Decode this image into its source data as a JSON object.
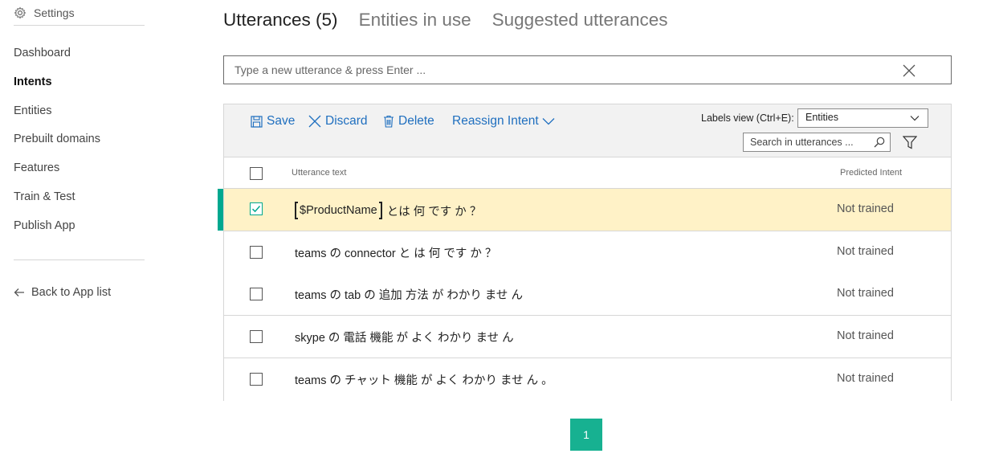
{
  "sidebar": {
    "settings_label": "Settings",
    "items": [
      {
        "label": "Dashboard"
      },
      {
        "label": "Intents"
      },
      {
        "label": "Entities"
      },
      {
        "label": "Prebuilt domains"
      },
      {
        "label": "Features"
      },
      {
        "label": "Train & Test"
      },
      {
        "label": "Publish App"
      }
    ],
    "back_label": "Back to App list"
  },
  "tabs": [
    {
      "label": "Utterances (5)"
    },
    {
      "label": "Entities in use"
    },
    {
      "label": "Suggested utterances"
    }
  ],
  "utterance_input": {
    "placeholder": "Type a new utterance & press Enter ...",
    "value": ""
  },
  "toolbar": {
    "save_label": "Save",
    "discard_label": "Discard",
    "delete_label": "Delete",
    "reassign_label": "Reassign Intent",
    "labels_view_label": "Labels view (Ctrl+E):",
    "labels_view_value": "Entities",
    "search_placeholder": "Search in utterances ..."
  },
  "table": {
    "columns": {
      "text": "Utterance text",
      "intent": "Predicted Intent"
    },
    "rows": [
      {
        "entity": "$ProductName",
        "text": "とは 何 です か ？",
        "status": "Not trained",
        "selected": true
      },
      {
        "text": "teams の connector と は 何 です か ？",
        "status": "Not trained",
        "selected": false
      },
      {
        "text": "teams の tab の 追加 方法 が わかり ませ ん",
        "status": "Not trained",
        "selected": false
      },
      {
        "text": "skype の 電話 機能 が よく わかり ませ ん",
        "status": "Not trained",
        "selected": false
      },
      {
        "text": "teams の チャット 機能 が よく わかり ませ ん 。",
        "status": "Not trained",
        "selected": false
      }
    ]
  },
  "pagination": {
    "current_page": "1"
  },
  "colors": {
    "accent": "#17b191",
    "link": "#1f6fbf",
    "selected_row": "#fff2c7"
  }
}
